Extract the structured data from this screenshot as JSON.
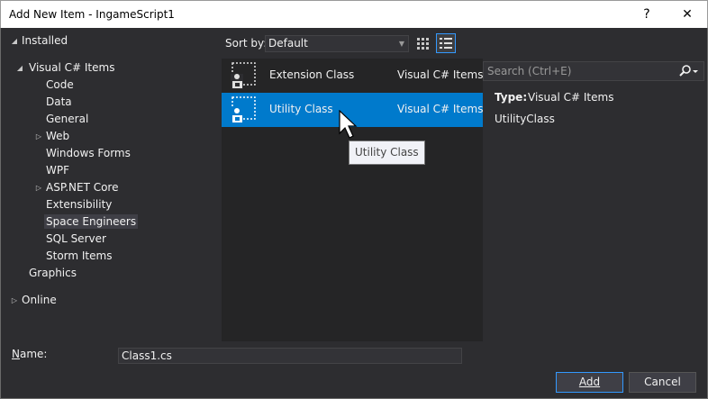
{
  "window": {
    "title": "Add New Item - IngameScript1",
    "help_glyph": "?",
    "close_glyph": "✕"
  },
  "tree": {
    "installed": "Installed",
    "visual_csharp_items": "Visual C# Items",
    "children": [
      "Code",
      "Data",
      "General",
      "Web",
      "Windows Forms",
      "WPF",
      "ASP.NET Core",
      "Extensibility",
      "Space Engineers",
      "SQL Server",
      "Storm Items"
    ],
    "graphics": "Graphics",
    "online": "Online",
    "selected": "Space Engineers"
  },
  "sort": {
    "label": "Sort by:",
    "value": "Default"
  },
  "items": [
    {
      "name": "Extension Class",
      "category": "Visual C# Items",
      "selected": false
    },
    {
      "name": "Utility Class",
      "category": "Visual C# Items",
      "selected": true
    }
  ],
  "tooltip": "Utility Class",
  "search": {
    "placeholder": "Search (Ctrl+E)"
  },
  "details": {
    "type_key": "Type:",
    "type_value": "Visual C# Items",
    "description": "UtilityClass"
  },
  "name_field": {
    "label_underlined": "N",
    "label_rest": "ame:",
    "value": "Class1.cs"
  },
  "buttons": {
    "add": "Add",
    "cancel": "Cancel"
  },
  "colors": {
    "accent": "#007acc",
    "background": "#2d2d30",
    "list_background": "#252526"
  }
}
